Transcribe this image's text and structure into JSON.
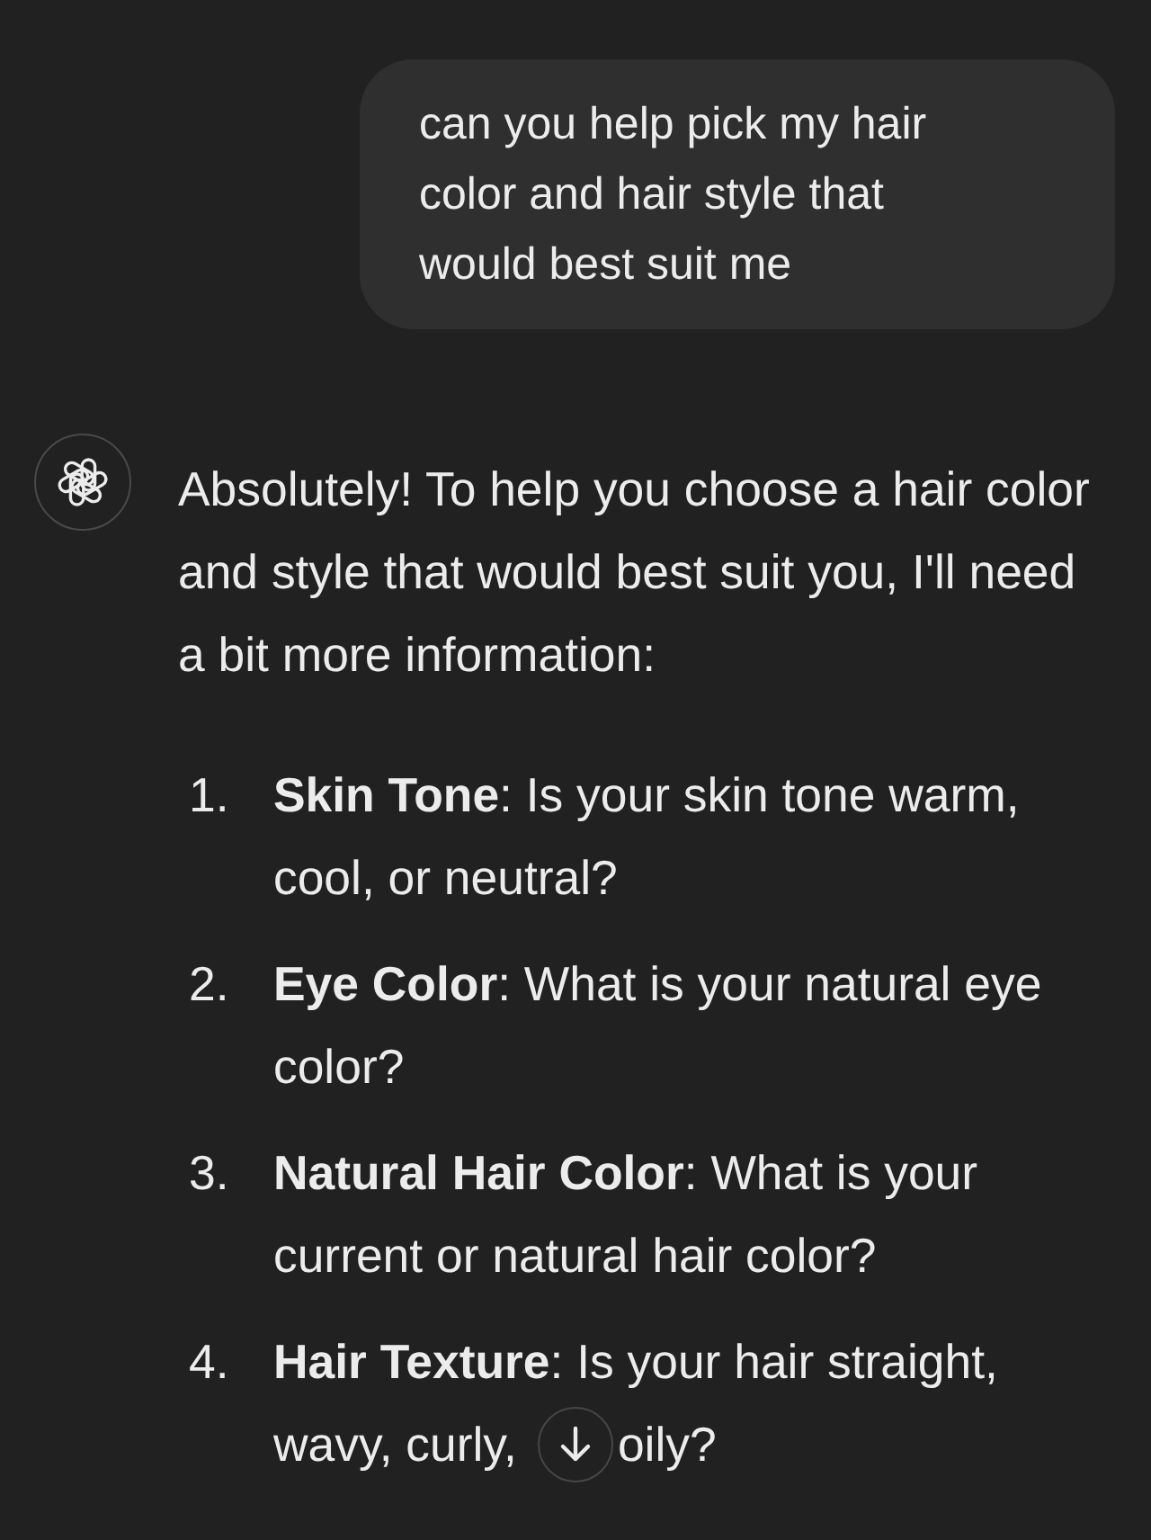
{
  "user_message": {
    "text": "can you help pick my hair color and hair style that would best suit me"
  },
  "assistant": {
    "intro": "Absolutely! To help you choose a hair color and style that would best suit you, I'll need a bit more information:",
    "list": [
      {
        "number": "1.",
        "text": "**Skin Tone**: Is your skin tone warm, cool, or neutral?"
      },
      {
        "number": "2.",
        "text": "**Eye Color**: What is your natural eye color?"
      },
      {
        "number": "3.",
        "text": "**Natural Hair Color**: What is your current or natural hair color?"
      },
      {
        "number": "4.",
        "text": "**Hair Texture**: Is your hair straight,",
        "covered_line": {
          "before": "wavy, curly,",
          "after": "oily?"
        }
      }
    ]
  }
}
